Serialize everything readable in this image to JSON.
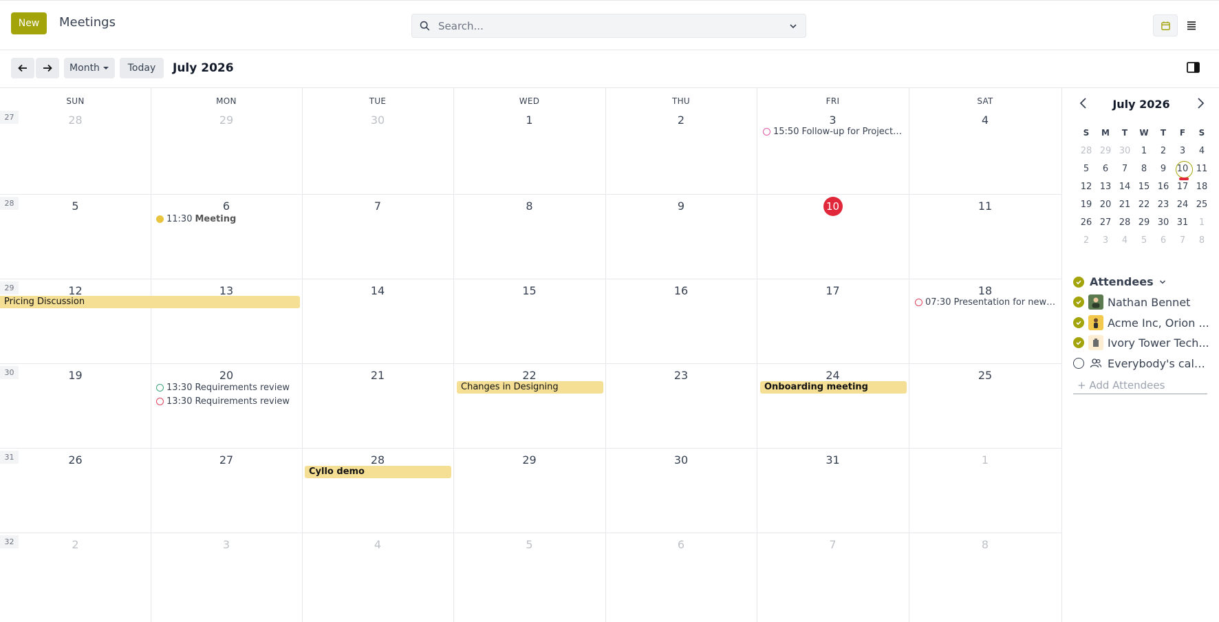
{
  "header": {
    "new_label": "New",
    "app_title": "Meetings",
    "search_placeholder": "Search..."
  },
  "toolbar": {
    "scale_label": "Month",
    "today_label": "Today",
    "range_label": "July 2026"
  },
  "calendar": {
    "weekdays": [
      "SUN",
      "MON",
      "TUE",
      "WED",
      "THU",
      "FRI",
      "SAT"
    ],
    "weeks": [
      {
        "num": "27",
        "days": [
          {
            "d": "28",
            "m": true
          },
          {
            "d": "29",
            "m": true
          },
          {
            "d": "30",
            "m": true
          },
          {
            "d": "1"
          },
          {
            "d": "2"
          },
          {
            "d": "3"
          },
          {
            "d": "4"
          }
        ]
      },
      {
        "num": "28",
        "days": [
          {
            "d": "5"
          },
          {
            "d": "6"
          },
          {
            "d": "7"
          },
          {
            "d": "8"
          },
          {
            "d": "9"
          },
          {
            "d": "10",
            "today": true
          },
          {
            "d": "11"
          }
        ]
      },
      {
        "num": "29",
        "days": [
          {
            "d": "12"
          },
          {
            "d": "13"
          },
          {
            "d": "14"
          },
          {
            "d": "15"
          },
          {
            "d": "16"
          },
          {
            "d": "17"
          },
          {
            "d": "18"
          }
        ]
      },
      {
        "num": "30",
        "days": [
          {
            "d": "19"
          },
          {
            "d": "20"
          },
          {
            "d": "21"
          },
          {
            "d": "22"
          },
          {
            "d": "23"
          },
          {
            "d": "24"
          },
          {
            "d": "25"
          }
        ]
      },
      {
        "num": "31",
        "days": [
          {
            "d": "26"
          },
          {
            "d": "27"
          },
          {
            "d": "28"
          },
          {
            "d": "29"
          },
          {
            "d": "30"
          },
          {
            "d": "31"
          },
          {
            "d": "1",
            "m": true
          }
        ]
      },
      {
        "num": "32",
        "days": [
          {
            "d": "2",
            "m": true
          },
          {
            "d": "3",
            "m": true
          },
          {
            "d": "4",
            "m": true
          },
          {
            "d": "5",
            "m": true
          },
          {
            "d": "6",
            "m": true
          },
          {
            "d": "7",
            "m": true
          },
          {
            "d": "8",
            "m": true
          }
        ]
      }
    ],
    "events": {
      "followup": {
        "time": "15:50",
        "title": "Follow-up for Project p...",
        "ring": "#e05aa6"
      },
      "meeting": {
        "time": "11:30",
        "title": "Meeting"
      },
      "pricing": {
        "title": "Pricing Discussion"
      },
      "presentation": {
        "time": "07:30",
        "title": "Presentation for new ...",
        "ring": "#e0405a"
      },
      "req1": {
        "time": "13:30",
        "title": "Requirements review",
        "ring": "#3aa57a"
      },
      "req2": {
        "time": "13:30",
        "title": "Requirements review",
        "ring": "#e0405a"
      },
      "changes": {
        "title": "Changes in Designing"
      },
      "onboarding": {
        "title": "Onboarding meeting"
      },
      "cyllo": {
        "title": "Cyllo demo"
      }
    }
  },
  "mini_calendar": {
    "title": "July 2026",
    "weekdays": [
      "S",
      "M",
      "T",
      "W",
      "T",
      "F",
      "S"
    ],
    "weeks": [
      [
        {
          "d": "28",
          "m": true
        },
        {
          "d": "29",
          "m": true
        },
        {
          "d": "30",
          "m": true
        },
        {
          "d": "1"
        },
        {
          "d": "2"
        },
        {
          "d": "3"
        },
        {
          "d": "4"
        }
      ],
      [
        {
          "d": "5"
        },
        {
          "d": "6"
        },
        {
          "d": "7"
        },
        {
          "d": "8"
        },
        {
          "d": "9"
        },
        {
          "d": "10"
        },
        {
          "d": "11"
        }
      ],
      [
        {
          "d": "12"
        },
        {
          "d": "13"
        },
        {
          "d": "14"
        },
        {
          "d": "15"
        },
        {
          "d": "16"
        },
        {
          "d": "17"
        },
        {
          "d": "18"
        }
      ],
      [
        {
          "d": "19"
        },
        {
          "d": "20"
        },
        {
          "d": "21"
        },
        {
          "d": "22"
        },
        {
          "d": "23"
        },
        {
          "d": "24"
        },
        {
          "d": "25"
        }
      ],
      [
        {
          "d": "26"
        },
        {
          "d": "27"
        },
        {
          "d": "28"
        },
        {
          "d": "29"
        },
        {
          "d": "30"
        },
        {
          "d": "31"
        },
        {
          "d": "1",
          "m": true
        }
      ],
      [
        {
          "d": "2",
          "m": true
        },
        {
          "d": "3",
          "m": true
        },
        {
          "d": "4",
          "m": true
        },
        {
          "d": "5",
          "m": true
        },
        {
          "d": "6",
          "m": true
        },
        {
          "d": "7",
          "m": true
        },
        {
          "d": "8",
          "m": true
        }
      ]
    ]
  },
  "attendees": {
    "heading": "Attendees",
    "items": [
      {
        "name": "Nathan Bennet",
        "checked": true
      },
      {
        "name": "Acme Inc, Orion ...",
        "checked": true
      },
      {
        "name": "Ivory Tower Tech...",
        "checked": true
      },
      {
        "name": "Everybody's cale...",
        "checked": false
      }
    ],
    "add_label": "+ Add Attendees"
  },
  "colors": {
    "accent": "#a3a30a",
    "today": "#e0283a",
    "event_bar": "#f5df94"
  }
}
